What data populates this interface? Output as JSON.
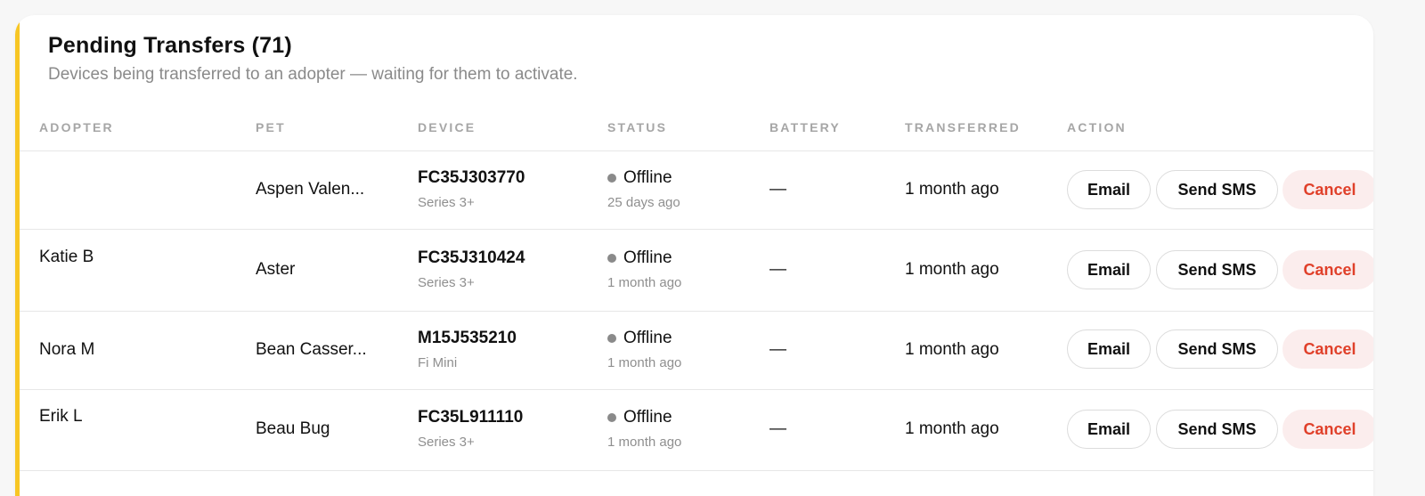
{
  "header": {
    "title": "Pending Transfers (71)",
    "subtitle": "Devices being transferred to an adopter — waiting for them to activate."
  },
  "columns": [
    "ADOPTER",
    "PET",
    "DEVICE",
    "STATUS",
    "BATTERY",
    "TRANSFERRED",
    "ACTION"
  ],
  "rows": [
    {
      "adopter": "",
      "pet": "Aspen Valen...",
      "device_id": "FC35J303770",
      "device_model": "Series 3+",
      "status": "Offline",
      "status_since": "25 days ago",
      "battery": "—",
      "transferred": "1 month ago"
    },
    {
      "adopter": "Katie B",
      "pet": "Aster",
      "device_id": "FC35J310424",
      "device_model": "Series 3+",
      "status": "Offline",
      "status_since": "1 month ago",
      "battery": "—",
      "transferred": "1 month ago"
    },
    {
      "adopter": "Nora M",
      "pet": "Bean Casser...",
      "device_id": "M15J535210",
      "device_model": "Fi Mini",
      "status": "Offline",
      "status_since": "1 month ago",
      "battery": "—",
      "transferred": "1 month ago"
    },
    {
      "adopter": "Erik L",
      "pet": "Beau Bug",
      "device_id": "FC35L911110",
      "device_model": "Series 3+",
      "status": "Offline",
      "status_since": "1 month ago",
      "battery": "—",
      "transferred": "1 month ago"
    }
  ],
  "actions": {
    "email_label": "Email",
    "sms_label": "Send SMS",
    "cancel_label": "Cancel"
  },
  "colors": {
    "accent": "#f7c624",
    "cancel_text": "#e0402a",
    "cancel_bg": "#fbeded",
    "status_offline": "#8a8a8a"
  },
  "icons": {
    "status": "status-dot-icon"
  }
}
